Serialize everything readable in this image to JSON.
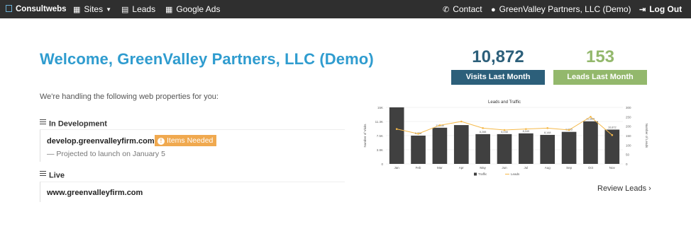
{
  "nav": {
    "brand_a": "Consult",
    "brand_b": "webs",
    "sites_label": "Sites",
    "leads_label": "Leads",
    "google_ads_label": "Google Ads",
    "contact_label": "Contact",
    "user_label": "GreenValley Partners, LLC (Demo)",
    "logout_label": "Log Out"
  },
  "welcome": {
    "title": "Welcome, GreenValley Partners, LLC (Demo)",
    "subtext": "We're handling the following web properties for you:"
  },
  "in_development": {
    "heading": "In Development",
    "domain": "develop.greenvalleyfirm.com",
    "badge": "Items Needed",
    "badge_icon": "!",
    "projected": "— Projected to launch on January 5"
  },
  "live": {
    "heading": "Live",
    "domain": "www.greenvalleyfirm.com"
  },
  "stats": {
    "visits_value": "10,872",
    "visits_label": "Visits Last Month",
    "leads_value": "153",
    "leads_label": "Leads Last Month"
  },
  "colors": {
    "brand_blue": "#2f9ccf",
    "visits": "#2c5f7a",
    "leads": "#93b86c",
    "badge": "#f0a94f",
    "bar": "#404040",
    "line": "#f5b94a"
  },
  "review_link": "Review Leads ›",
  "chart_data": {
    "type": "bar",
    "title": "Leads and Traffic",
    "ylabel": "Number of Visits",
    "y2label": "Number of Leads",
    "categories": [
      "Jan",
      "Feb",
      "Mar",
      "Apr",
      "May",
      "Jun",
      "Jul",
      "Aug",
      "Sep",
      "Oct",
      "Nov"
    ],
    "series": [
      {
        "name": "Traffic",
        "type": "bar",
        "values": [
          15000,
          7500,
          9600,
          10300,
          7900,
          7900,
          8100,
          7700,
          8500,
          11300,
          9100
        ],
        "data_labels": [
          "",
          "8,338",
          "11,258",
          "",
          "8,288",
          "8,038",
          "8,049",
          "8,148",
          "9,005",
          "12,886",
          "10,872"
        ]
      },
      {
        "name": "Leads",
        "type": "line",
        "values": [
          185,
          160,
          205,
          225,
          190,
          180,
          185,
          190,
          180,
          250,
          153
        ]
      }
    ],
    "ylim": [
      0,
      15000
    ],
    "y2lim": [
      0,
      300
    ],
    "yticks": [
      "0",
      "3.8K",
      "7.5K",
      "11.3K",
      "15K"
    ],
    "y2ticks": [
      "0",
      "50",
      "100",
      "150",
      "200",
      "250",
      "300"
    ],
    "grid": true,
    "legend": "bottom"
  }
}
